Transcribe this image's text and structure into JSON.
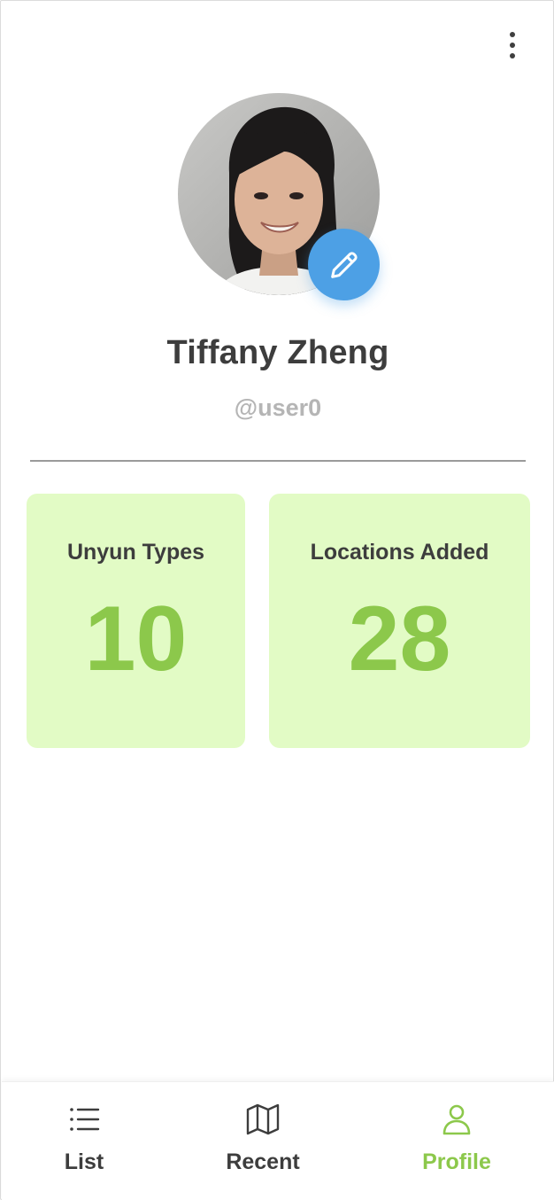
{
  "profile": {
    "name": "Tiffany Zheng",
    "handle": "@user0"
  },
  "stats": [
    {
      "label": "Unyun Types",
      "value": "10"
    },
    {
      "label": "Locations Added",
      "value": "28"
    }
  ],
  "tabs": [
    {
      "label": "List",
      "icon": "list-icon",
      "active": false
    },
    {
      "label": "Recent",
      "icon": "map-icon",
      "active": false
    },
    {
      "label": "Profile",
      "icon": "user-icon",
      "active": true
    }
  ],
  "colors": {
    "accent_green": "#8cc84b",
    "card_bg": "#e2fbc5",
    "edit_blue": "#4da0e5",
    "text_dark": "#3d3d3d",
    "text_muted": "#b5b5b5"
  },
  "icons": {
    "menu": "more-vertical-icon",
    "edit": "pencil-icon"
  }
}
